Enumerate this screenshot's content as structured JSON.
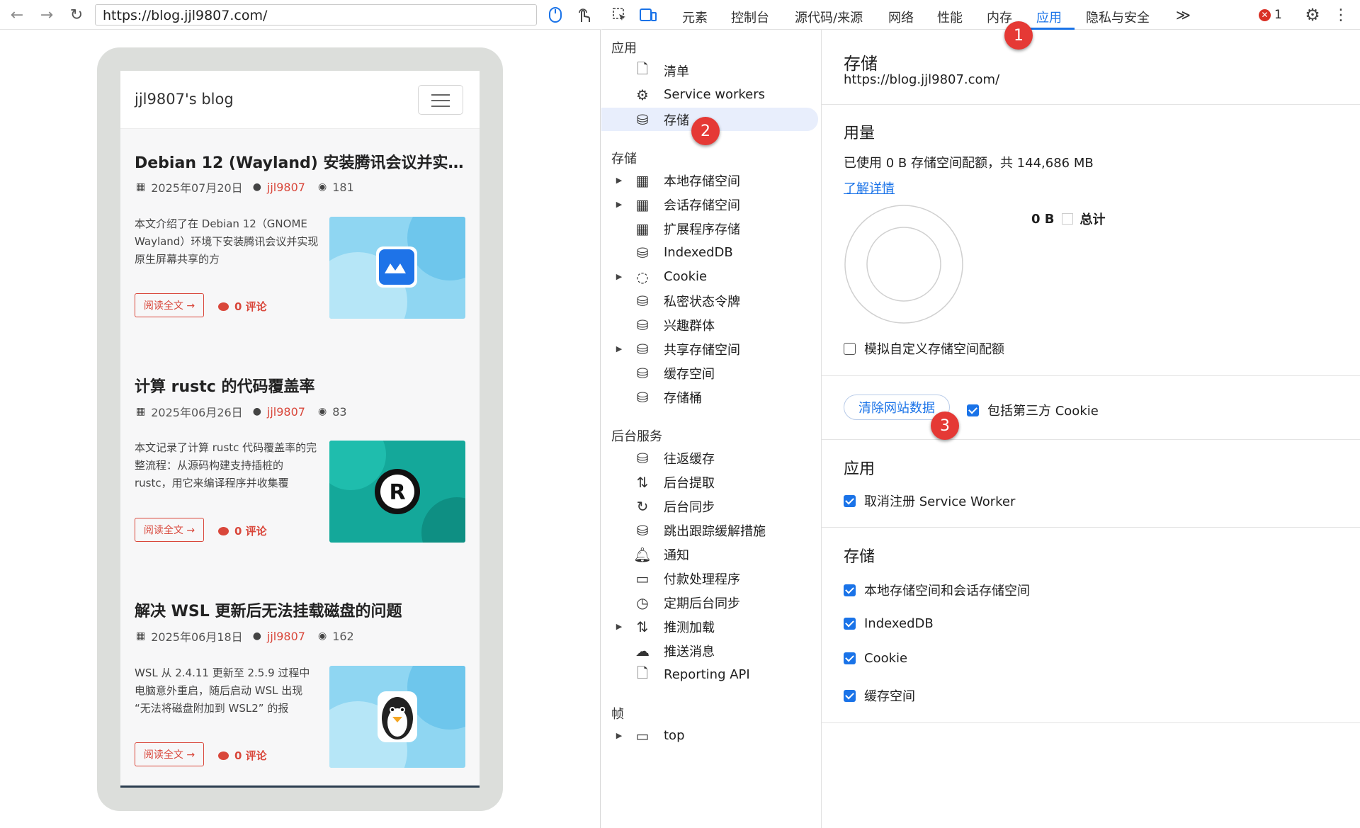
{
  "browser": {
    "url": "https://blog.jjl9807.com/"
  },
  "blog": {
    "brand": "jjl9807's blog",
    "posts": [
      {
        "title": "Debian 12 (Wayland) 安装腾讯会议并实现...",
        "date": "2025年07月20日",
        "author": "jjl9807",
        "views": "181",
        "excerpt": "本文介绍了在 Debian 12（GNOME Wayland）环境下安装腾讯会议并实现原生屏幕共享的方",
        "read_more": "阅读全文 →",
        "comments": "0 评论"
      },
      {
        "title": "计算 rustc 的代码覆盖率",
        "date": "2025年06月26日",
        "author": "jjl9807",
        "views": "83",
        "excerpt": "本文记录了计算 rustc 代码覆盖率的完整流程：从源码构建支持插桩的 rustc，用它来编译程序并收集覆",
        "read_more": "阅读全文 →",
        "comments": "0 评论"
      },
      {
        "title": "解决 WSL 更新后无法挂载磁盘的问题",
        "date": "2025年06月18日",
        "author": "jjl9807",
        "views": "162",
        "excerpt": "WSL 从 2.4.11 更新至 2.5.9 过程中电脑意外重启，随后启动 WSL 出现 “无法将磁盘附加到 WSL2” 的报",
        "read_more": "阅读全文 →",
        "comments": "0 评论"
      }
    ]
  },
  "devtools": {
    "tabs": [
      "元素",
      "控制台",
      "源代码/来源",
      "网络",
      "性能",
      "内存",
      "应用",
      "隐私与安全"
    ],
    "more_tabs": "≫",
    "error_count": "1",
    "sidebar": {
      "app_header": "应用",
      "app_items": [
        "清单",
        "Service workers",
        "存储"
      ],
      "storage_header": "存储",
      "storage_items": [
        "本地存储空间",
        "会话存储空间",
        "扩展程序存储",
        "IndexedDB",
        "Cookie",
        "私密状态令牌",
        "兴趣群体",
        "共享存储空间",
        "缓存空间",
        "存储桶"
      ],
      "bg_header": "后台服务",
      "bg_items": [
        "往返缓存",
        "后台提取",
        "后台同步",
        "跳出跟踪缓解措施",
        "通知",
        "付款处理程序",
        "定期后台同步",
        "推测加载",
        "推送消息",
        "Reporting API"
      ],
      "frames_header": "帧",
      "frames_items": [
        "top"
      ]
    },
    "main": {
      "title": "存储",
      "origin": "https://blog.jjl9807.com/",
      "usage_header": "用量",
      "usage_text": "已使用 0 B 存储空间配额，共 144,686 MB",
      "learn_more": "了解详情",
      "legend_value": "0 B",
      "legend_label": "总计",
      "simulate_quota": "模拟自定义存储空间配额",
      "clear_button": "清除网站数据",
      "include_third_party": "包括第三方 Cookie",
      "app_header": "应用",
      "unregister_sw": "取消注册 Service Worker",
      "storage_header": "存储",
      "storage_options": [
        "本地存储空间和会话存储空间",
        "IndexedDB",
        "Cookie",
        "缓存空间"
      ]
    },
    "annotations": [
      "1",
      "2",
      "3"
    ]
  },
  "colors": {
    "accent": "#1a73e8",
    "blog_red": "#d9473b",
    "badge_red": "#e53935"
  }
}
